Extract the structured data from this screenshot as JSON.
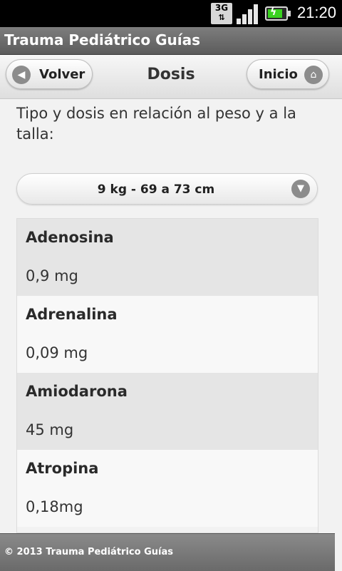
{
  "status_bar": {
    "network_label": "3G",
    "time": "21:20",
    "icons": [
      "network-3g-icon",
      "signal-icon",
      "battery-charging-icon"
    ]
  },
  "app_title": "Trauma Pediátrico Guías",
  "header": {
    "back_label": "Volver",
    "title": "Dosis",
    "home_label": "Inicio"
  },
  "intro_text": "Tipo y dosis en relación al peso y a la talla:",
  "weight_select": {
    "selected": "9 kg - 69 a 73 cm"
  },
  "drugs": [
    {
      "name": "Adenosina",
      "dose": "0,9 mg"
    },
    {
      "name": "Adrenalina",
      "dose": "0,09 mg"
    },
    {
      "name": "Amiodarona",
      "dose": "45 mg"
    },
    {
      "name": "Atropina",
      "dose": "0,18mg"
    }
  ],
  "footer": "© 2013 Trauma  Pediátrico  Guías",
  "colors": {
    "battery_green": "#39d21f",
    "app_title_bg": "#6b6b6b",
    "row_dark": "#e5e5e5",
    "row_light": "#f8f8f8"
  }
}
